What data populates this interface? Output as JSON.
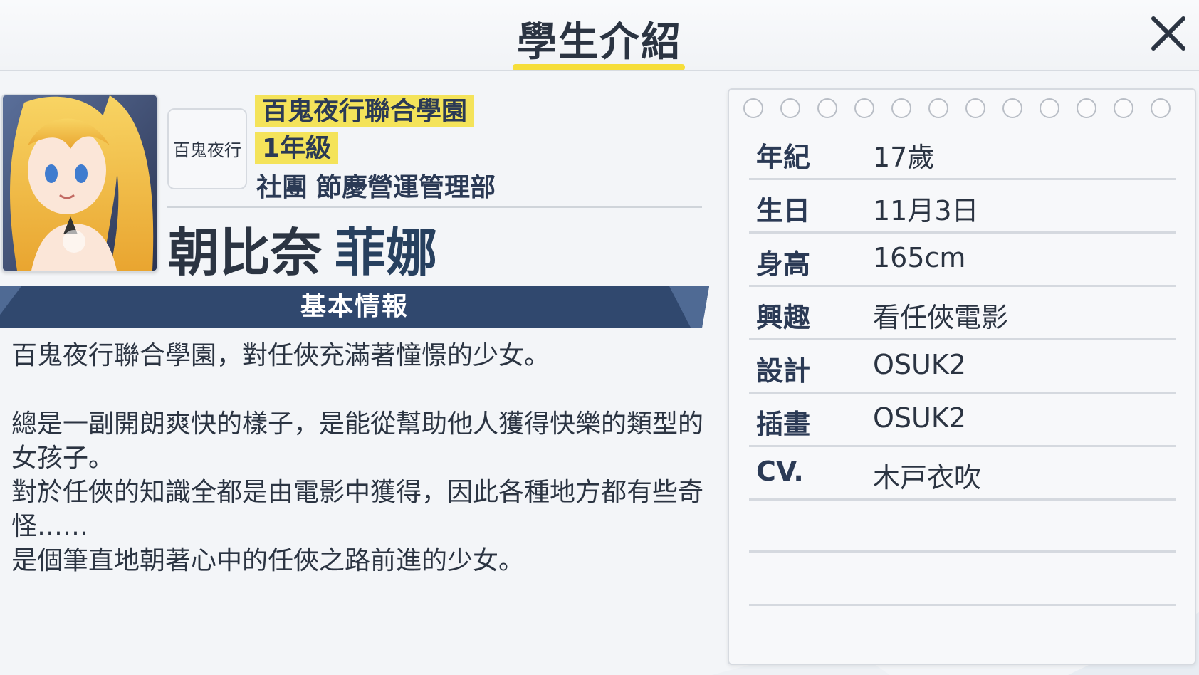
{
  "header": {
    "title": "學生介紹",
    "close_icon": "close-icon"
  },
  "profile": {
    "school": "百鬼夜行聯合學園",
    "grade": "1年級",
    "club_label": "社團",
    "club_name": "節慶營運管理部",
    "family_name": "朝比奈",
    "given_name": "菲娜",
    "school_logo_text": "百鬼夜行"
  },
  "basic_info": {
    "section_title": "基本情報",
    "paragraphs": [
      "百鬼夜行聯合學園，對任俠充滿著憧憬的少女。",
      "總是一副開朗爽快的樣子，是能從幫助他人獲得快樂的類型的女孩子。",
      "對於任俠的知識全都是由電影中獲得，因此各種地方都有些奇怪……",
      "是個筆直地朝著心中的任俠之路前進的少女。"
    ]
  },
  "details": [
    {
      "label": "年紀",
      "value": "17歲"
    },
    {
      "label": "生日",
      "value": "11月3日"
    },
    {
      "label": "身高",
      "value": "165cm"
    },
    {
      "label": "興趣",
      "value": "看任俠電影"
    },
    {
      "label": "設計",
      "value": "OSUK2"
    },
    {
      "label": "插畫",
      "value": "OSUK2"
    },
    {
      "label": "CV.",
      "value": "木戸衣吹"
    }
  ],
  "colors": {
    "accent_yellow": "#f4e35a",
    "navy": "#2f4a72",
    "text": "#2b3442"
  }
}
